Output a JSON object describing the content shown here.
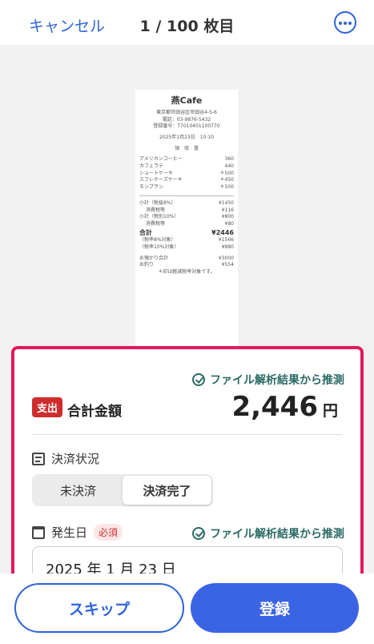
{
  "header": {
    "cancel_label": "キャンセル",
    "counter": "1 / 100 枚目"
  },
  "receipt": {
    "store": "燕Cafe",
    "address": "東京都世田谷区世田谷4-5-6",
    "phone": "電話：03-9876-5432",
    "registration": "登録番号：T7010401100770",
    "datetime": "2025年1月23日　10:10",
    "doc_title": "領　収　書",
    "items": [
      {
        "name": "アメリカンコーヒー",
        "price": "360"
      },
      {
        "name": "カフェラテ",
        "price": "440"
      },
      {
        "name": "ショートケーキ",
        "price": "＊500"
      },
      {
        "name": "スフレチーズケーキ",
        "price": "＊450"
      },
      {
        "name": "モンブラン",
        "price": "＊500"
      }
    ],
    "subtotals": [
      {
        "name": "小計（税抜8%）",
        "price": "¥1450",
        "indent": false
      },
      {
        "name": "消費税等",
        "price": "¥116",
        "indent": true
      },
      {
        "name": "小計（税別10%）",
        "price": "¥800",
        "indent": false
      },
      {
        "name": "消費税等",
        "price": "¥80",
        "indent": true
      }
    ],
    "total_label": "合計",
    "total_value": "¥2446",
    "tax_breakdown": [
      {
        "name": "（税率8%対象）",
        "price": "¥1566"
      },
      {
        "name": "（税率10%対象）",
        "price": "¥880"
      }
    ],
    "payment": [
      {
        "name": "お預かり合計",
        "price": "¥3000"
      },
      {
        "name": "お釣り",
        "price": "¥554"
      }
    ],
    "note": "＊印は軽減税率対象です。"
  },
  "form": {
    "inferred_label": "ファイル解析結果から推測",
    "type_badge": "支出",
    "total_label": "合計金額",
    "amount": "2,446",
    "currency": "円",
    "payment_status_label": "決済状況",
    "payment_options": [
      "未決済",
      "決済完了"
    ],
    "selected_payment": "決済完了",
    "date_label": "発生日",
    "required_label": "必須",
    "date_value": "2025 年 1 月 23 日"
  },
  "footer": {
    "skip_label": "スキップ",
    "register_label": "登録"
  },
  "colors": {
    "accent": "#2f63d8",
    "primary_button": "#3a64e4",
    "highlight_border": "#e5185f",
    "expense_badge": "#cf2d2d",
    "inferred_text": "#2a6a65"
  }
}
